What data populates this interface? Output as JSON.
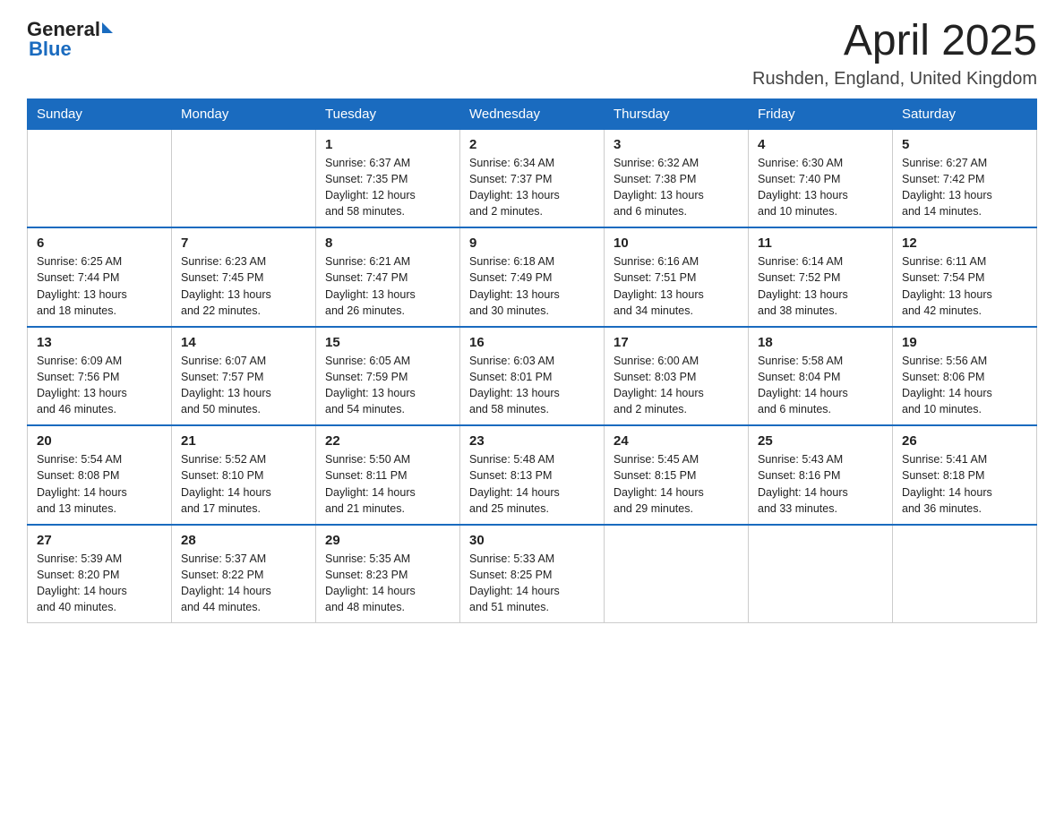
{
  "logo": {
    "general": "General",
    "blue": "Blue"
  },
  "title": "April 2025",
  "location": "Rushden, England, United Kingdom",
  "weekdays": [
    "Sunday",
    "Monday",
    "Tuesday",
    "Wednesday",
    "Thursday",
    "Friday",
    "Saturday"
  ],
  "weeks": [
    [
      {
        "day": "",
        "info": ""
      },
      {
        "day": "",
        "info": ""
      },
      {
        "day": "1",
        "info": "Sunrise: 6:37 AM\nSunset: 7:35 PM\nDaylight: 12 hours\nand 58 minutes."
      },
      {
        "day": "2",
        "info": "Sunrise: 6:34 AM\nSunset: 7:37 PM\nDaylight: 13 hours\nand 2 minutes."
      },
      {
        "day": "3",
        "info": "Sunrise: 6:32 AM\nSunset: 7:38 PM\nDaylight: 13 hours\nand 6 minutes."
      },
      {
        "day": "4",
        "info": "Sunrise: 6:30 AM\nSunset: 7:40 PM\nDaylight: 13 hours\nand 10 minutes."
      },
      {
        "day": "5",
        "info": "Sunrise: 6:27 AM\nSunset: 7:42 PM\nDaylight: 13 hours\nand 14 minutes."
      }
    ],
    [
      {
        "day": "6",
        "info": "Sunrise: 6:25 AM\nSunset: 7:44 PM\nDaylight: 13 hours\nand 18 minutes."
      },
      {
        "day": "7",
        "info": "Sunrise: 6:23 AM\nSunset: 7:45 PM\nDaylight: 13 hours\nand 22 minutes."
      },
      {
        "day": "8",
        "info": "Sunrise: 6:21 AM\nSunset: 7:47 PM\nDaylight: 13 hours\nand 26 minutes."
      },
      {
        "day": "9",
        "info": "Sunrise: 6:18 AM\nSunset: 7:49 PM\nDaylight: 13 hours\nand 30 minutes."
      },
      {
        "day": "10",
        "info": "Sunrise: 6:16 AM\nSunset: 7:51 PM\nDaylight: 13 hours\nand 34 minutes."
      },
      {
        "day": "11",
        "info": "Sunrise: 6:14 AM\nSunset: 7:52 PM\nDaylight: 13 hours\nand 38 minutes."
      },
      {
        "day": "12",
        "info": "Sunrise: 6:11 AM\nSunset: 7:54 PM\nDaylight: 13 hours\nand 42 minutes."
      }
    ],
    [
      {
        "day": "13",
        "info": "Sunrise: 6:09 AM\nSunset: 7:56 PM\nDaylight: 13 hours\nand 46 minutes."
      },
      {
        "day": "14",
        "info": "Sunrise: 6:07 AM\nSunset: 7:57 PM\nDaylight: 13 hours\nand 50 minutes."
      },
      {
        "day": "15",
        "info": "Sunrise: 6:05 AM\nSunset: 7:59 PM\nDaylight: 13 hours\nand 54 minutes."
      },
      {
        "day": "16",
        "info": "Sunrise: 6:03 AM\nSunset: 8:01 PM\nDaylight: 13 hours\nand 58 minutes."
      },
      {
        "day": "17",
        "info": "Sunrise: 6:00 AM\nSunset: 8:03 PM\nDaylight: 14 hours\nand 2 minutes."
      },
      {
        "day": "18",
        "info": "Sunrise: 5:58 AM\nSunset: 8:04 PM\nDaylight: 14 hours\nand 6 minutes."
      },
      {
        "day": "19",
        "info": "Sunrise: 5:56 AM\nSunset: 8:06 PM\nDaylight: 14 hours\nand 10 minutes."
      }
    ],
    [
      {
        "day": "20",
        "info": "Sunrise: 5:54 AM\nSunset: 8:08 PM\nDaylight: 14 hours\nand 13 minutes."
      },
      {
        "day": "21",
        "info": "Sunrise: 5:52 AM\nSunset: 8:10 PM\nDaylight: 14 hours\nand 17 minutes."
      },
      {
        "day": "22",
        "info": "Sunrise: 5:50 AM\nSunset: 8:11 PM\nDaylight: 14 hours\nand 21 minutes."
      },
      {
        "day": "23",
        "info": "Sunrise: 5:48 AM\nSunset: 8:13 PM\nDaylight: 14 hours\nand 25 minutes."
      },
      {
        "day": "24",
        "info": "Sunrise: 5:45 AM\nSunset: 8:15 PM\nDaylight: 14 hours\nand 29 minutes."
      },
      {
        "day": "25",
        "info": "Sunrise: 5:43 AM\nSunset: 8:16 PM\nDaylight: 14 hours\nand 33 minutes."
      },
      {
        "day": "26",
        "info": "Sunrise: 5:41 AM\nSunset: 8:18 PM\nDaylight: 14 hours\nand 36 minutes."
      }
    ],
    [
      {
        "day": "27",
        "info": "Sunrise: 5:39 AM\nSunset: 8:20 PM\nDaylight: 14 hours\nand 40 minutes."
      },
      {
        "day": "28",
        "info": "Sunrise: 5:37 AM\nSunset: 8:22 PM\nDaylight: 14 hours\nand 44 minutes."
      },
      {
        "day": "29",
        "info": "Sunrise: 5:35 AM\nSunset: 8:23 PM\nDaylight: 14 hours\nand 48 minutes."
      },
      {
        "day": "30",
        "info": "Sunrise: 5:33 AM\nSunset: 8:25 PM\nDaylight: 14 hours\nand 51 minutes."
      },
      {
        "day": "",
        "info": ""
      },
      {
        "day": "",
        "info": ""
      },
      {
        "day": "",
        "info": ""
      }
    ]
  ],
  "colors": {
    "header_bg": "#1a6bbf",
    "header_text": "#ffffff",
    "border": "#cccccc",
    "row_divider": "#1a6bbf"
  }
}
